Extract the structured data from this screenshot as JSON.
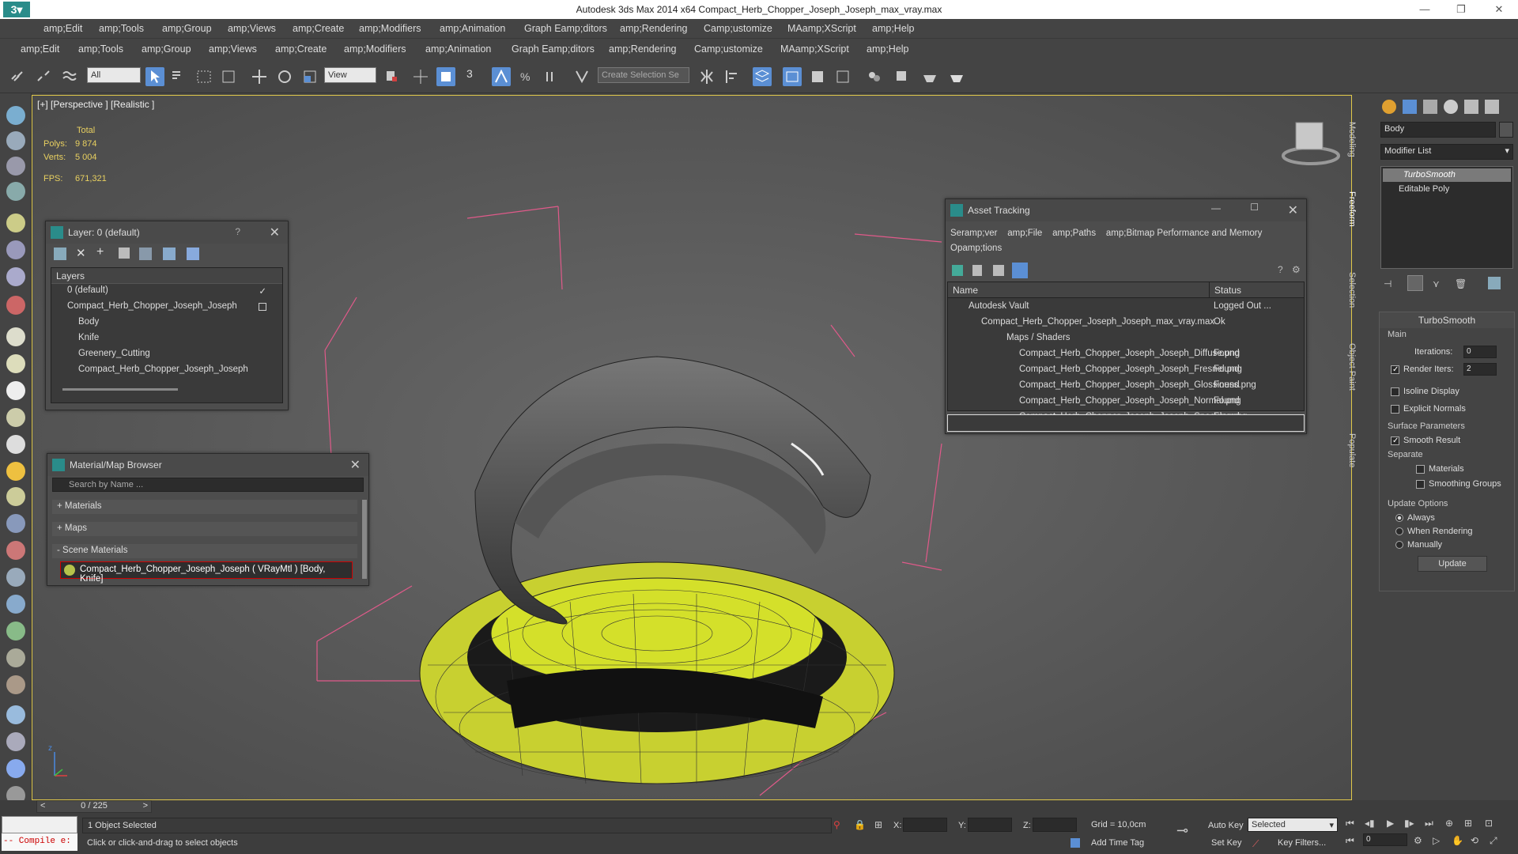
{
  "window": {
    "title": "Autodesk 3ds Max  2014 x64     Compact_Herb_Chopper_Joseph_Joseph_max_vray.max"
  },
  "menu1": [
    "amp;Edit",
    "amp;Tools",
    "amp;Group",
    "amp;Views",
    "amp;Create",
    "amp;Modifiers",
    "amp;Animation",
    "Graph Eamp;ditors",
    "amp;Rendering",
    "Camp;ustomize",
    "MAamp;XScript",
    "amp;Help"
  ],
  "menu2": [
    "amp;Edit",
    "amp;Tools",
    "amp;Group",
    "amp;Views",
    "amp;Create",
    "amp;Modifiers",
    "amp;Animation",
    "Graph Eamp;ditors",
    "amp;Rendering",
    "Camp;ustomize",
    "MAamp;XScript",
    "amp;Help"
  ],
  "toolbar": {
    "filter_value": "All",
    "refcoord_value": "View",
    "selection_set_placeholder": "Create Selection Se",
    "snap_label": "3"
  },
  "viewport": {
    "label": "[+] [Perspective ] [Realistic ]",
    "stats": {
      "total_label": "Total",
      "polys_label": "Polys:",
      "polys_value": "9 874",
      "verts_label": "Verts:",
      "verts_value": "5 004",
      "fps_label": "FPS:",
      "fps_value": "671,321"
    },
    "frame_counter": "0 / 225",
    "axis_z": "z"
  },
  "layer_panel": {
    "title": "Layer: 0 (default)",
    "help": "?",
    "header": "Layers",
    "items": [
      "0 (default)",
      "Compact_Herb_Chopper_Joseph_Joseph",
      "Body",
      "Knife",
      "Greenery_Cutting",
      "Compact_Herb_Chopper_Joseph_Joseph"
    ]
  },
  "material_browser": {
    "title": "Material/Map Browser",
    "search_placeholder": "Search by Name ...",
    "sections": [
      "+ Materials",
      "+ Maps",
      "- Scene Materials"
    ],
    "scene_material": "Compact_Herb_Chopper_Joseph_Joseph ( VRayMtl ) [Body, Knife]"
  },
  "asset_tracking": {
    "title": "Asset Tracking",
    "menu": [
      "Seramp;ver",
      "amp;File",
      "amp;Paths",
      "amp;Bitmap Performance and Memory",
      "Opamp;tions"
    ],
    "col_name": "Name",
    "col_status": "Status",
    "rows": [
      {
        "name": "Autodesk Vault",
        "status": "Logged Out ..."
      },
      {
        "name": "Compact_Herb_Chopper_Joseph_Joseph_max_vray.max",
        "status": "Ok"
      },
      {
        "name": "Maps / Shaders",
        "status": ""
      },
      {
        "name": "Compact_Herb_Chopper_Joseph_Joseph_Diffuse.png",
        "status": "Found"
      },
      {
        "name": "Compact_Herb_Chopper_Joseph_Joseph_Fresnel.png",
        "status": "Found"
      },
      {
        "name": "Compact_Herb_Chopper_Joseph_Joseph_Glossiness.png",
        "status": "Found"
      },
      {
        "name": "Compact_Herb_Chopper_Joseph_Joseph_Normal.png",
        "status": "Found"
      },
      {
        "name": "Compact_Herb_Chopper_Joseph_Joseph_Specular.png",
        "status": "Found"
      }
    ]
  },
  "side_tabs": [
    "Modeling",
    "Freeform",
    "Selection",
    "Object Paint",
    "Populate"
  ],
  "command_panel": {
    "object_name": "Body",
    "modifier_list": "Modifier List",
    "stack": [
      "TurboSmooth",
      "Editable Poly"
    ],
    "rollout_title": "TurboSmooth",
    "main_label": "Main",
    "iterations_label": "Iterations:",
    "iterations_value": "0",
    "render_iters_label": "Render Iters:",
    "render_iters_value": "2",
    "isoline_label": "Isoline Display",
    "explicit_label": "Explicit Normals",
    "surface_label": "Surface Parameters",
    "smooth_label": "Smooth Result",
    "separate_label": "Separate",
    "materials_label": "Materials",
    "smoothing_label": "Smoothing Groups",
    "update_label": "Update Options",
    "always_label": "Always",
    "when_rendering_label": "When Rendering",
    "manually_label": "Manually",
    "update_button": "Update"
  },
  "status": {
    "maxscript": "-- Compile e:",
    "selected": "1 Object Selected",
    "prompt": "Click or click-and-drag to select objects",
    "x_label": "X:",
    "y_label": "Y:",
    "z_label": "Z:",
    "grid": "Grid = 10,0cm",
    "auto_key": "Auto Key",
    "set_key": "Set Key",
    "selected_dropdown": "Selected",
    "key_filters": "Key Filters...",
    "add_time_tag": "Add Time Tag",
    "frame_value": "0"
  },
  "colors": {
    "accent": "#5b8fd4",
    "viewport_border": "#e0c84a",
    "wire_yellow": "#d4e02a",
    "bbox_pink": "#e05a8a"
  }
}
